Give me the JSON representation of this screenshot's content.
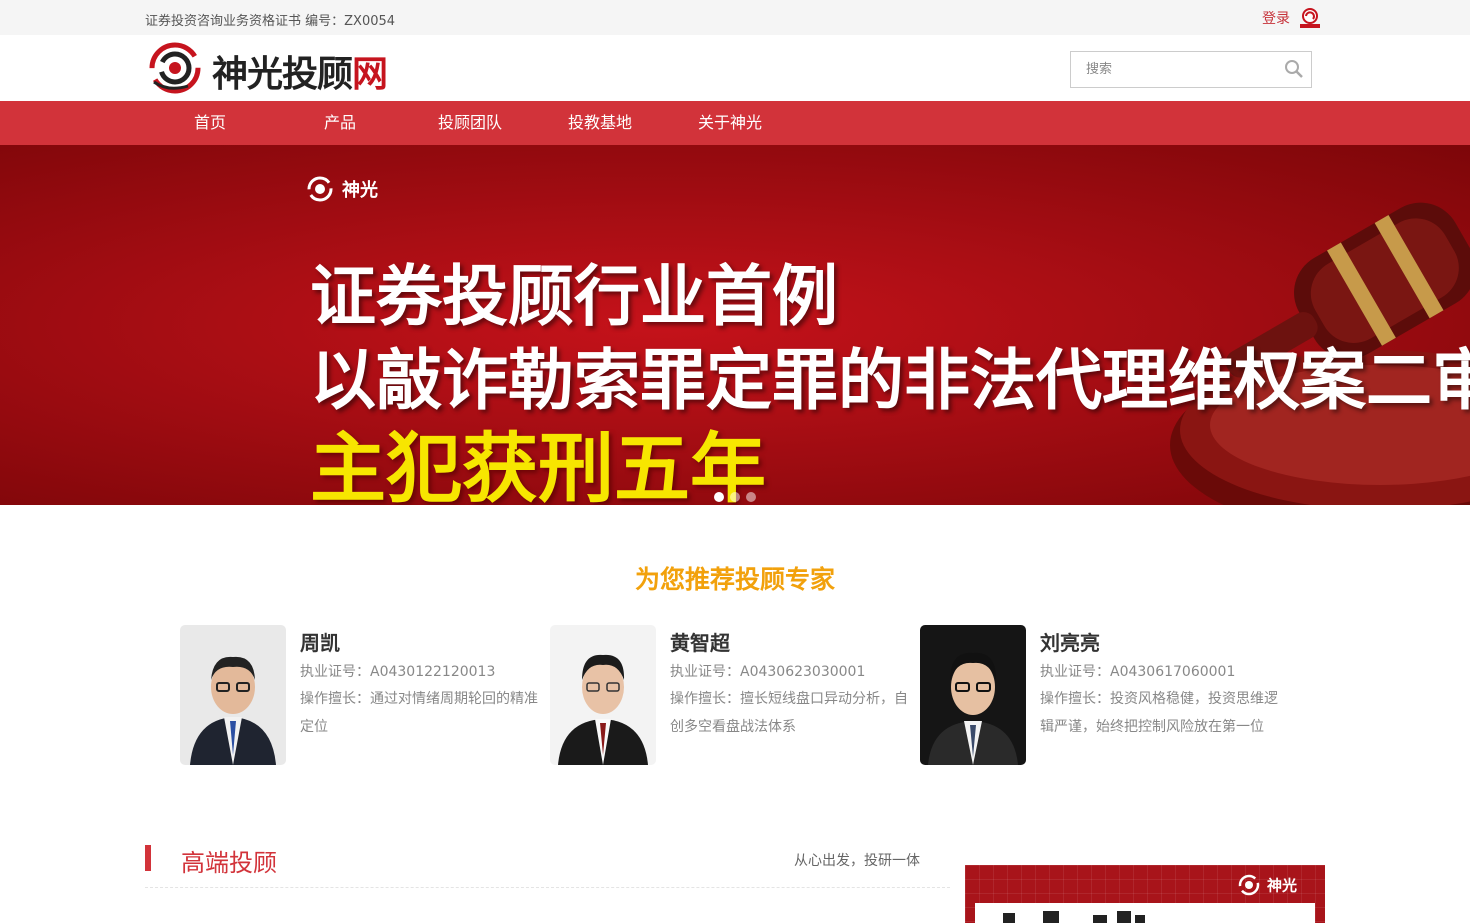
{
  "topbar": {
    "certificate": "证券投资咨询业务资格证书 编号：ZX0054",
    "login_label": "登录"
  },
  "header": {
    "logo_text": "神光投顾",
    "logo_text_suffix": "网",
    "search_placeholder": "搜索"
  },
  "nav": {
    "items": [
      {
        "label": "首页"
      },
      {
        "label": "产品"
      },
      {
        "label": "投顾团队"
      },
      {
        "label": "投教基地"
      },
      {
        "label": "关于神光"
      }
    ]
  },
  "banner": {
    "brand": "神光",
    "line1": "证券投顾行业首例",
    "line2": "以敲诈勒索罪定罪的非法代理维权案二审",
    "line3": "主犯获刑五年",
    "slide_count": 3,
    "active_slide": 1
  },
  "experts": {
    "title": "为您推荐投顾专家",
    "list": [
      {
        "name": "周凯",
        "license": "执业证号：A0430122120013",
        "specialty": "操作擅长：通过对情绪周期轮回的精准定位"
      },
      {
        "name": "黄智超",
        "license": "执业证号：A0430623030001",
        "specialty": "操作擅长：擅长短线盘口异动分析，自创多空看盘战法体系"
      },
      {
        "name": "刘亮亮",
        "license": "执业证号：A0430617060001",
        "specialty": "操作擅长：投资风格稳健，投资思维逻辑严谨，始终把控制风险放在第一位"
      }
    ]
  },
  "high_end": {
    "title": "高端投顾",
    "slogan": "从心出发，投研一体"
  },
  "ad": {
    "brand": "神光"
  },
  "colors": {
    "brand_red": "#d2333a",
    "accent_orange": "#f2a10c",
    "banner_yellow": "#f7e600"
  }
}
